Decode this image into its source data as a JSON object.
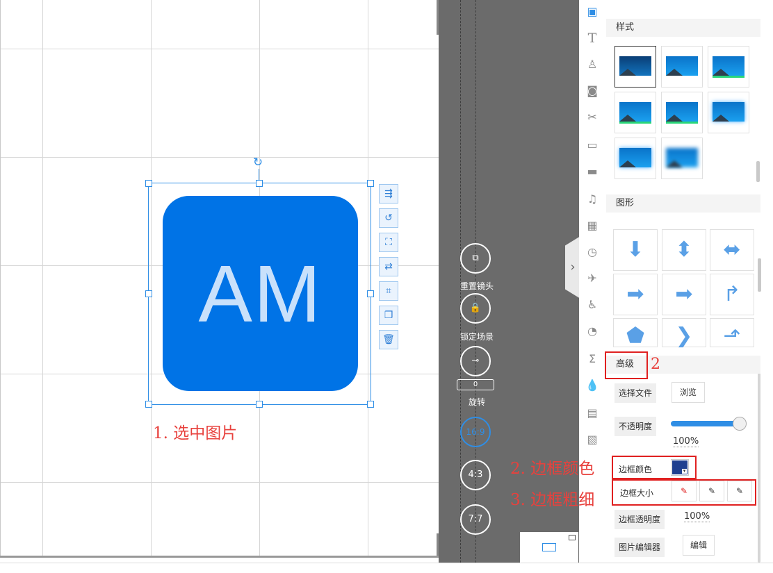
{
  "canvas": {
    "image_text": "AM"
  },
  "annotations": {
    "select_image": "1. 选中图片",
    "advanced_num": "2",
    "border_color": "2. 边框颜色",
    "border_size": "3. 边框粗细"
  },
  "image_tools": [
    {
      "icon": "align-icon",
      "glyph": "⇶"
    },
    {
      "icon": "rotate-icon",
      "glyph": "↺"
    },
    {
      "icon": "crop-icon",
      "glyph": "⛶"
    },
    {
      "icon": "replace-icon",
      "glyph": "⇄"
    },
    {
      "icon": "fit-icon",
      "glyph": "⌗"
    },
    {
      "icon": "layer-icon",
      "glyph": "❐"
    },
    {
      "icon": "delete-icon",
      "glyph": "🗑"
    }
  ],
  "stage_controls": {
    "reset_lens": "重置镜头",
    "lock_scene": "锁定场景",
    "rotate": "旋转",
    "rotate_value": "0",
    "ratio_16_9": "16:9",
    "ratio_4_3": "4:3",
    "ratio_7_7": "7:7"
  },
  "rail_icons": [
    "image-icon",
    "text-icon",
    "figure-icon",
    "camera-icon",
    "tools-icon",
    "speech-bubble-icon",
    "folder-icon",
    "music-icon",
    "film-icon",
    "clock-icon",
    "plane-icon",
    "person-icon",
    "pie-chart-icon",
    "sigma-icon",
    "droplet-icon",
    "scanner-icon",
    "picture-icon"
  ],
  "panel": {
    "style_title": "样式",
    "shape_title": "图形",
    "advanced_title": "高级",
    "choose_file_label": "选择文件",
    "browse_label": "浏览",
    "opacity_label": "不透明度",
    "opacity_value": "100%",
    "border_color_label": "边框颜色",
    "border_size_label": "边框大小",
    "border_opacity_label": "边框透明度",
    "border_opacity_value": "100%",
    "image_editor_label": "图片编辑器",
    "edit_label": "编辑"
  },
  "colors": {
    "accent": "#2f8ee5",
    "annotation": "#e8413d",
    "border_color_swatch": "#1f3f8f"
  }
}
